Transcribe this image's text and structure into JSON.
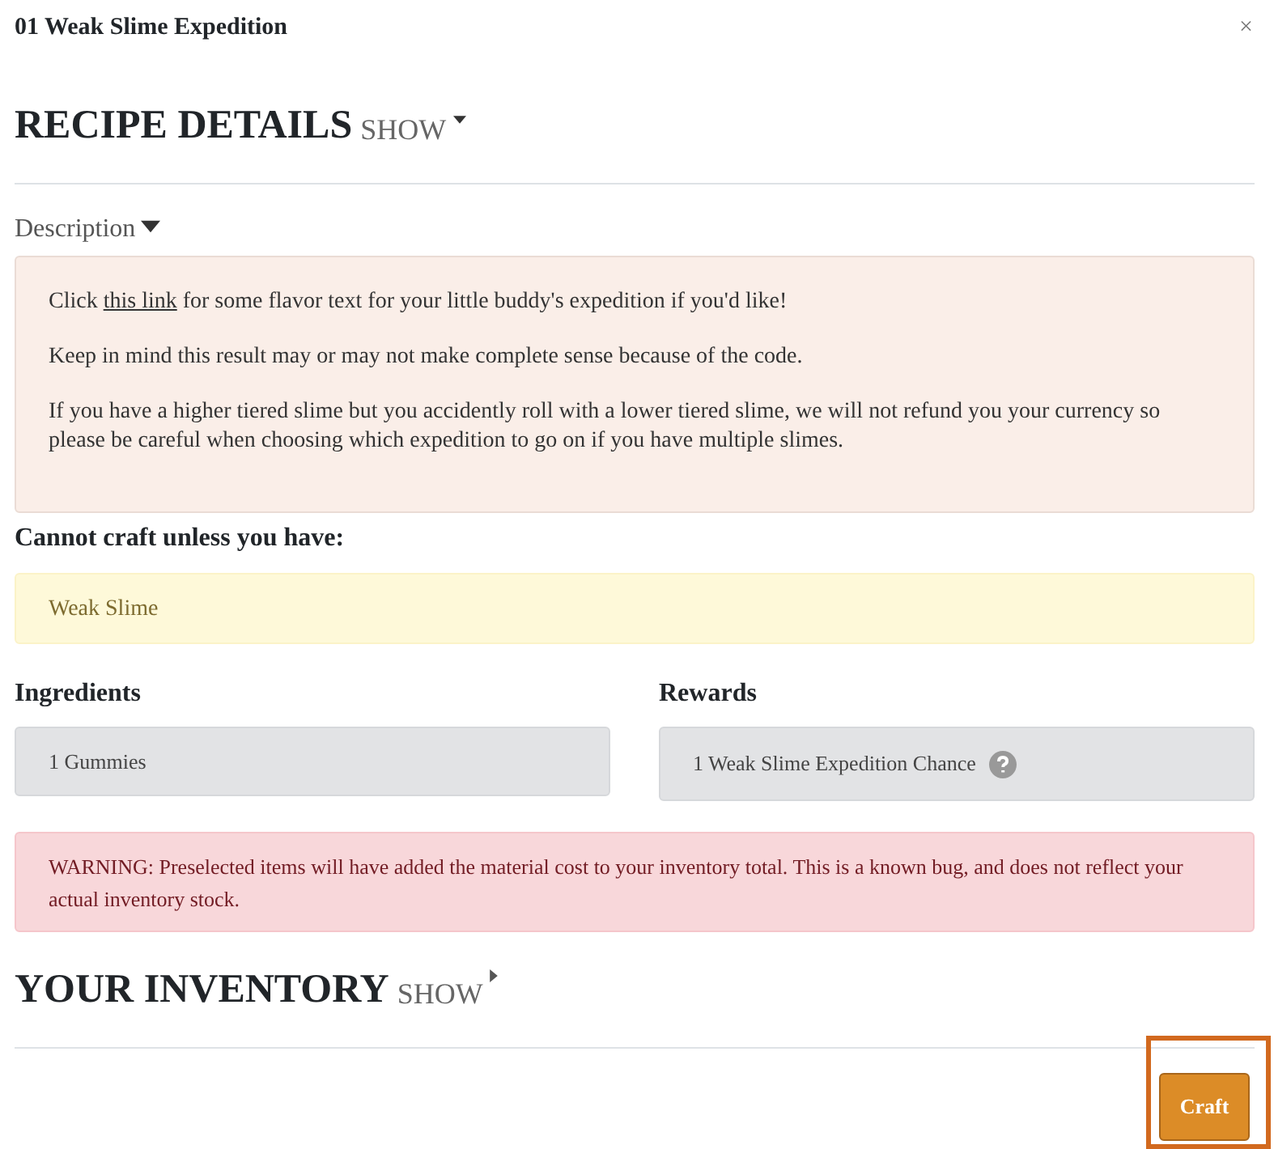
{
  "modal": {
    "title": "01 Weak Slime Expedition",
    "close": "×"
  },
  "recipe_details": {
    "heading": "RECIPE DETAILS",
    "toggle": "SHOW",
    "expanded": true
  },
  "description": {
    "label": "Description",
    "expanded": true,
    "paragraphs": [
      {
        "before": "Click ",
        "link": "this link",
        "after": " for some flavor text for your little buddy's expedition if you'd like!"
      },
      {
        "before": "Keep in mind this result may or may not make complete sense because of the code."
      },
      {
        "before": "If you have a higher tiered slime but you accidently roll with a lower tiered slime, we will not refund you your currency so please be careful when choosing which expedition to go on if you have multiple slimes."
      }
    ]
  },
  "requirement": {
    "label": "Cannot craft unless you have:",
    "items": [
      "Weak Slime"
    ]
  },
  "ingredients": {
    "label": "Ingredients",
    "items": [
      "1 Gummies"
    ]
  },
  "rewards": {
    "label": "Rewards",
    "items": [
      "1 Weak Slime Expedition Chance"
    ]
  },
  "warning": "WARNING: Preselected items will have added the material cost to your inventory total. This is a known bug, and does not reflect your actual inventory stock.",
  "inventory": {
    "heading": "YOUR INVENTORY",
    "toggle": "SHOW",
    "expanded": false
  },
  "craft_button": {
    "label": "Craft",
    "highlighted": true
  }
}
